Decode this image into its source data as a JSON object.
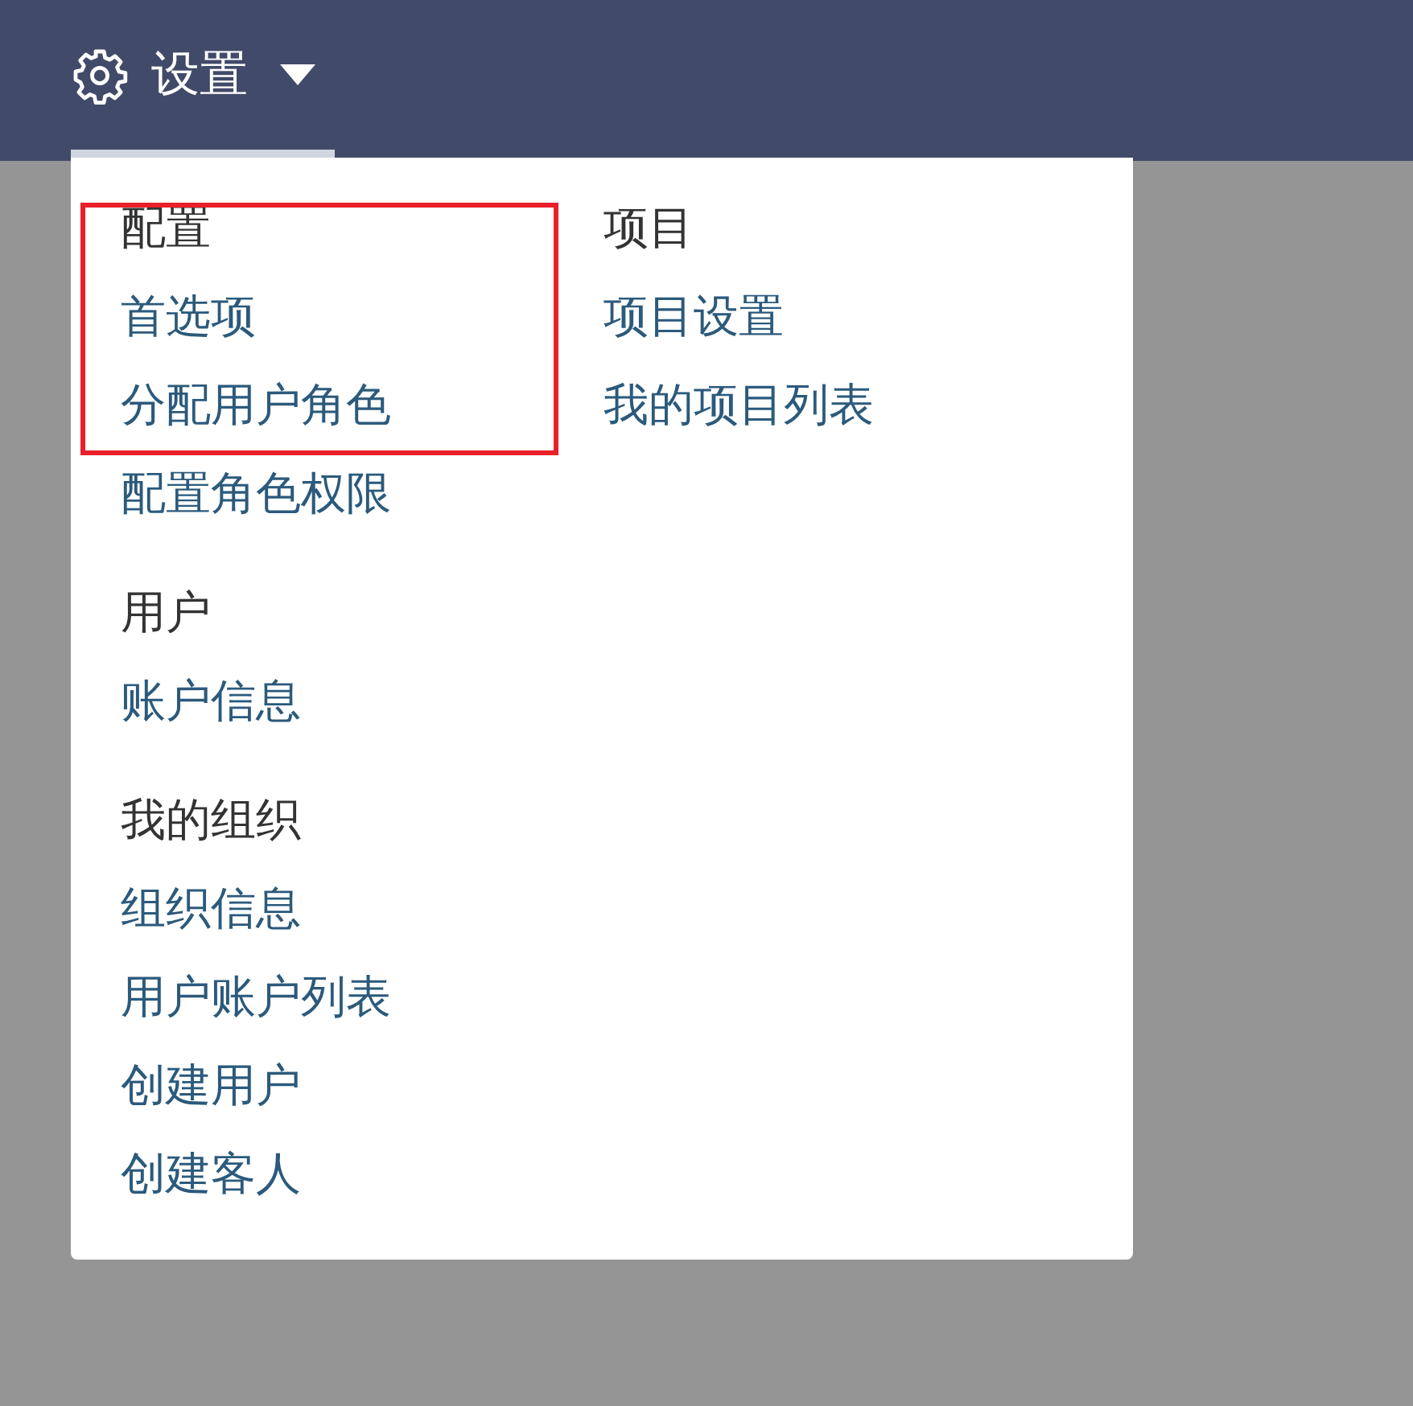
{
  "settings_menu": {
    "label": "设置",
    "expanded": true,
    "columns": [
      {
        "sections": [
          {
            "heading": "配置",
            "links": [
              "首选项",
              "分配用户角色",
              "配置角色权限"
            ]
          },
          {
            "heading": "用户",
            "links": [
              "账户信息"
            ]
          },
          {
            "heading": "我的组织",
            "links": [
              "组织信息",
              "用户账户列表",
              "创建用户",
              "创建客人"
            ]
          }
        ]
      },
      {
        "sections": [
          {
            "heading": "项目",
            "links": [
              "项目设置",
              "我的项目列表"
            ]
          }
        ]
      }
    ]
  },
  "annotations": [
    {
      "kind": "rectangle"
    }
  ]
}
